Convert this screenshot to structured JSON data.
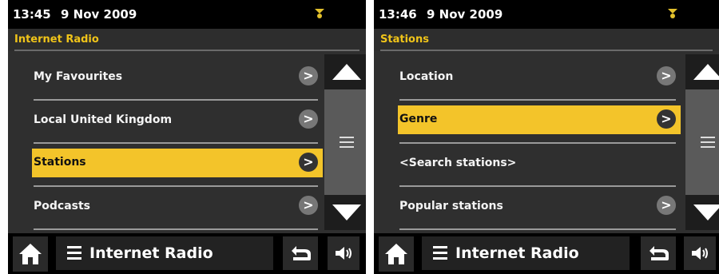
{
  "colors": {
    "accent": "#f3c42a",
    "title_text": "#f0c419",
    "background": "#2f2f2f"
  },
  "screens": [
    {
      "status": {
        "time": "13:45",
        "date": "9 Nov 2009",
        "icon": "radio-signal-icon"
      },
      "title": "Internet Radio",
      "items": [
        {
          "label": "My Favourites",
          "arrow": ">"
        },
        {
          "label": "Local United Kingdom",
          "arrow": ">"
        },
        {
          "label": "Stations",
          "arrow": ">"
        },
        {
          "label": "Podcasts",
          "arrow": ">"
        }
      ],
      "selected_index": 2,
      "mode_label": "Internet Radio"
    },
    {
      "status": {
        "time": "13:46",
        "date": "9 Nov 2009",
        "icon": "radio-signal-icon"
      },
      "title": "Stations",
      "items": [
        {
          "label": "Location",
          "arrow": ">"
        },
        {
          "label": "Genre",
          "arrow": ">"
        },
        {
          "label": "<Search stations>",
          "arrow": ""
        },
        {
          "label": "Popular stations",
          "arrow": ">"
        }
      ],
      "selected_index": 1,
      "mode_label": "Internet Radio"
    }
  ]
}
